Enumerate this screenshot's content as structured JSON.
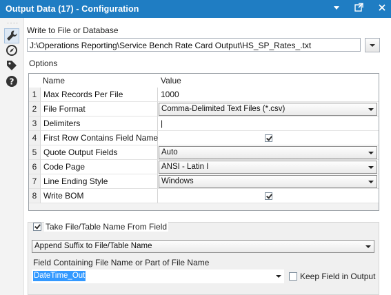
{
  "window": {
    "title": "Output Data (17) - Configuration"
  },
  "left_rail": {
    "icons": [
      "wrench-icon",
      "compass-icon",
      "tag-icon",
      "help-icon"
    ]
  },
  "write_to": {
    "label": "Write to File or Database",
    "path": "J:\\Operations Reporting\\Service Bench Rate Card Output\\HS_SP_Rates_.txt"
  },
  "options": {
    "label": "Options",
    "columns": [
      "Name",
      "Value"
    ],
    "rows": [
      {
        "num": "1",
        "name": "Max Records Per File",
        "value": "1000",
        "kind": "text"
      },
      {
        "num": "2",
        "name": "File Format",
        "value": "Comma-Delimited Text Files (*.csv)",
        "kind": "dropdown"
      },
      {
        "num": "3",
        "name": "Delimiters",
        "value": "|",
        "kind": "text"
      },
      {
        "num": "4",
        "name": "First Row Contains Field Names",
        "value": "checked",
        "kind": "checkbox"
      },
      {
        "num": "5",
        "name": "Quote Output Fields",
        "value": "Auto",
        "kind": "dropdown"
      },
      {
        "num": "6",
        "name": "Code Page",
        "value": "ANSI - Latin I",
        "kind": "dropdown"
      },
      {
        "num": "7",
        "name": "Line Ending Style",
        "value": "Windows",
        "kind": "dropdown"
      },
      {
        "num": "8",
        "name": "Write BOM",
        "value": "checked",
        "kind": "checkbox"
      }
    ]
  },
  "take_name": {
    "checkbox_label": "Take File/Table Name From Field",
    "checked": true,
    "mode": "Append Suffix to File/Table Name",
    "field_label": "Field Containing File Name or Part of File Name",
    "field_value": "DateTime_Out",
    "keep_label": "Keep Field in Output",
    "keep_checked": false
  }
}
